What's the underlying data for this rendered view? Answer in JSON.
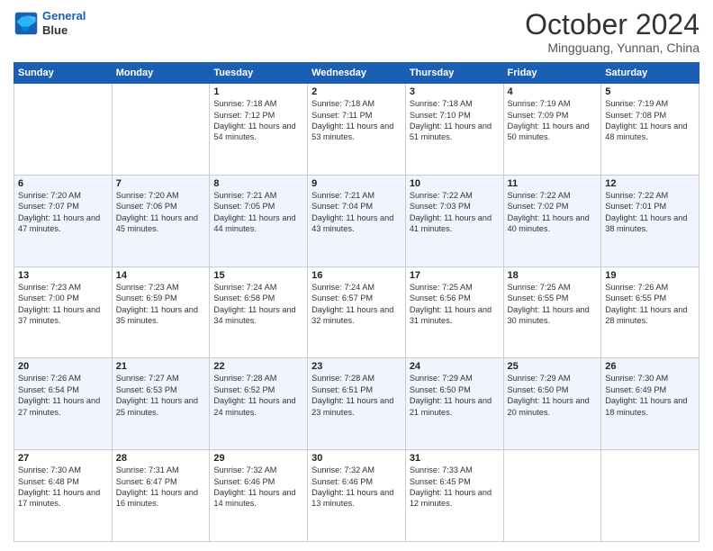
{
  "logo": {
    "line1": "General",
    "line2": "Blue"
  },
  "header": {
    "month": "October 2024",
    "location": "Mingguang, Yunnan, China"
  },
  "weekdays": [
    "Sunday",
    "Monday",
    "Tuesday",
    "Wednesday",
    "Thursday",
    "Friday",
    "Saturday"
  ],
  "weeks": [
    [
      {
        "day": "",
        "info": ""
      },
      {
        "day": "",
        "info": ""
      },
      {
        "day": "1",
        "info": "Sunrise: 7:18 AM\nSunset: 7:12 PM\nDaylight: 11 hours and 54 minutes."
      },
      {
        "day": "2",
        "info": "Sunrise: 7:18 AM\nSunset: 7:11 PM\nDaylight: 11 hours and 53 minutes."
      },
      {
        "day": "3",
        "info": "Sunrise: 7:18 AM\nSunset: 7:10 PM\nDaylight: 11 hours and 51 minutes."
      },
      {
        "day": "4",
        "info": "Sunrise: 7:19 AM\nSunset: 7:09 PM\nDaylight: 11 hours and 50 minutes."
      },
      {
        "day": "5",
        "info": "Sunrise: 7:19 AM\nSunset: 7:08 PM\nDaylight: 11 hours and 48 minutes."
      }
    ],
    [
      {
        "day": "6",
        "info": "Sunrise: 7:20 AM\nSunset: 7:07 PM\nDaylight: 11 hours and 47 minutes."
      },
      {
        "day": "7",
        "info": "Sunrise: 7:20 AM\nSunset: 7:06 PM\nDaylight: 11 hours and 45 minutes."
      },
      {
        "day": "8",
        "info": "Sunrise: 7:21 AM\nSunset: 7:05 PM\nDaylight: 11 hours and 44 minutes."
      },
      {
        "day": "9",
        "info": "Sunrise: 7:21 AM\nSunset: 7:04 PM\nDaylight: 11 hours and 43 minutes."
      },
      {
        "day": "10",
        "info": "Sunrise: 7:22 AM\nSunset: 7:03 PM\nDaylight: 11 hours and 41 minutes."
      },
      {
        "day": "11",
        "info": "Sunrise: 7:22 AM\nSunset: 7:02 PM\nDaylight: 11 hours and 40 minutes."
      },
      {
        "day": "12",
        "info": "Sunrise: 7:22 AM\nSunset: 7:01 PM\nDaylight: 11 hours and 38 minutes."
      }
    ],
    [
      {
        "day": "13",
        "info": "Sunrise: 7:23 AM\nSunset: 7:00 PM\nDaylight: 11 hours and 37 minutes."
      },
      {
        "day": "14",
        "info": "Sunrise: 7:23 AM\nSunset: 6:59 PM\nDaylight: 11 hours and 35 minutes."
      },
      {
        "day": "15",
        "info": "Sunrise: 7:24 AM\nSunset: 6:58 PM\nDaylight: 11 hours and 34 minutes."
      },
      {
        "day": "16",
        "info": "Sunrise: 7:24 AM\nSunset: 6:57 PM\nDaylight: 11 hours and 32 minutes."
      },
      {
        "day": "17",
        "info": "Sunrise: 7:25 AM\nSunset: 6:56 PM\nDaylight: 11 hours and 31 minutes."
      },
      {
        "day": "18",
        "info": "Sunrise: 7:25 AM\nSunset: 6:55 PM\nDaylight: 11 hours and 30 minutes."
      },
      {
        "day": "19",
        "info": "Sunrise: 7:26 AM\nSunset: 6:55 PM\nDaylight: 11 hours and 28 minutes."
      }
    ],
    [
      {
        "day": "20",
        "info": "Sunrise: 7:26 AM\nSunset: 6:54 PM\nDaylight: 11 hours and 27 minutes."
      },
      {
        "day": "21",
        "info": "Sunrise: 7:27 AM\nSunset: 6:53 PM\nDaylight: 11 hours and 25 minutes."
      },
      {
        "day": "22",
        "info": "Sunrise: 7:28 AM\nSunset: 6:52 PM\nDaylight: 11 hours and 24 minutes."
      },
      {
        "day": "23",
        "info": "Sunrise: 7:28 AM\nSunset: 6:51 PM\nDaylight: 11 hours and 23 minutes."
      },
      {
        "day": "24",
        "info": "Sunrise: 7:29 AM\nSunset: 6:50 PM\nDaylight: 11 hours and 21 minutes."
      },
      {
        "day": "25",
        "info": "Sunrise: 7:29 AM\nSunset: 6:50 PM\nDaylight: 11 hours and 20 minutes."
      },
      {
        "day": "26",
        "info": "Sunrise: 7:30 AM\nSunset: 6:49 PM\nDaylight: 11 hours and 18 minutes."
      }
    ],
    [
      {
        "day": "27",
        "info": "Sunrise: 7:30 AM\nSunset: 6:48 PM\nDaylight: 11 hours and 17 minutes."
      },
      {
        "day": "28",
        "info": "Sunrise: 7:31 AM\nSunset: 6:47 PM\nDaylight: 11 hours and 16 minutes."
      },
      {
        "day": "29",
        "info": "Sunrise: 7:32 AM\nSunset: 6:46 PM\nDaylight: 11 hours and 14 minutes."
      },
      {
        "day": "30",
        "info": "Sunrise: 7:32 AM\nSunset: 6:46 PM\nDaylight: 11 hours and 13 minutes."
      },
      {
        "day": "31",
        "info": "Sunrise: 7:33 AM\nSunset: 6:45 PM\nDaylight: 11 hours and 12 minutes."
      },
      {
        "day": "",
        "info": ""
      },
      {
        "day": "",
        "info": ""
      }
    ]
  ]
}
